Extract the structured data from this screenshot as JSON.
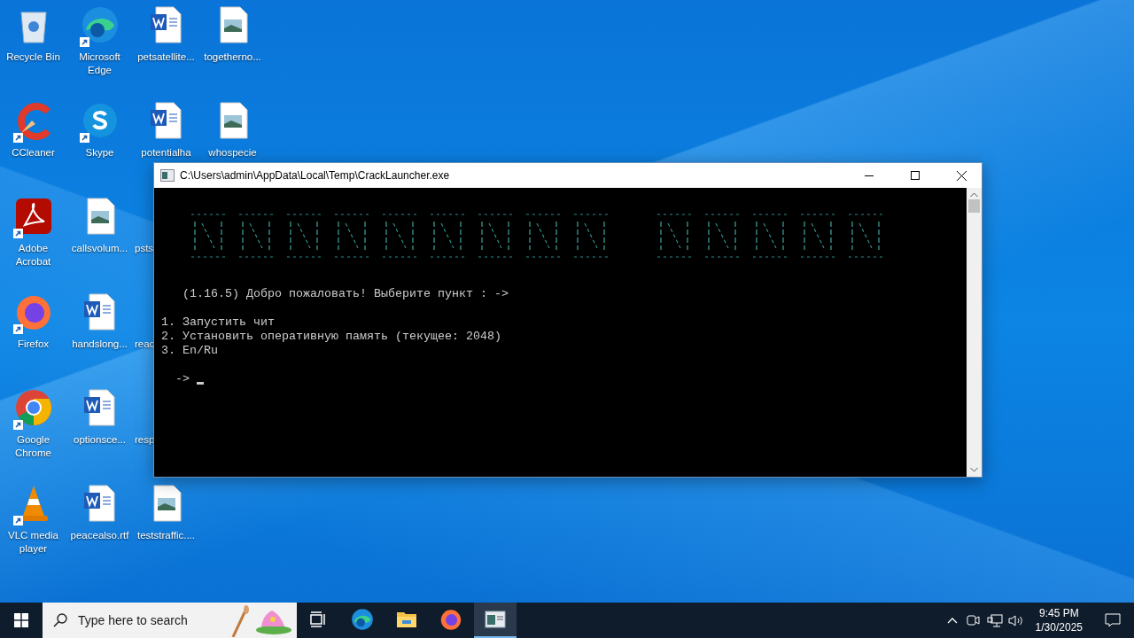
{
  "desktop_icons": [
    {
      "label": "Recycle Bin",
      "kind": "recycle-bin",
      "shortcut": false
    },
    {
      "label": "CCleaner",
      "kind": "ccleaner",
      "shortcut": true
    },
    {
      "label": "Adobe Acrobat",
      "kind": "acrobat",
      "shortcut": true
    },
    {
      "label": "Firefox",
      "kind": "firefox",
      "shortcut": true
    },
    {
      "label": "Google Chrome",
      "kind": "chrome",
      "shortcut": true
    },
    {
      "label": "VLC media player",
      "kind": "vlc",
      "shortcut": true
    },
    {
      "label": "Microsoft Edge",
      "kind": "edge",
      "shortcut": true
    },
    {
      "label": "Skype",
      "kind": "skype",
      "shortcut": true
    },
    {
      "label": "callsvolum...",
      "kind": "image",
      "shortcut": false
    },
    {
      "label": "handslong...",
      "kind": "word",
      "shortcut": false
    },
    {
      "label": "optionsce...",
      "kind": "word",
      "shortcut": false
    },
    {
      "label": "peacealso.rtf",
      "kind": "word",
      "shortcut": false
    },
    {
      "label": "petsatellite...",
      "kind": "word",
      "shortcut": false
    },
    {
      "label": "potentialha",
      "kind": "word",
      "shortcut": false
    },
    {
      "label": "psts",
      "kind": "hidden",
      "shortcut": false
    },
    {
      "label": "reac",
      "kind": "hidden",
      "shortcut": false
    },
    {
      "label": "resp",
      "kind": "hidden",
      "shortcut": false
    },
    {
      "label": "teststraffic....",
      "kind": "image",
      "shortcut": false
    },
    {
      "label": "togetherno...",
      "kind": "image",
      "shortcut": false
    },
    {
      "label": "whospecie",
      "kind": "image",
      "shortcut": false
    }
  ],
  "console": {
    "title": "C:\\Users\\admin\\AppData\\Local\\Temp\\CrackLauncher.exe",
    "greeting": "(1.16.5) Добро пожаловать! Выберите пункт : ->",
    "menu": [
      "1. Запустить чит",
      "2. Установить оперативную память (текущее: 2048)",
      "3. En/Ru"
    ],
    "prompt": "->"
  },
  "taskbar": {
    "search_placeholder": "Type here to search",
    "apps": [
      {
        "kind": "task-view",
        "selected": false
      },
      {
        "kind": "edge",
        "selected": false
      },
      {
        "kind": "explorer",
        "selected": false
      },
      {
        "kind": "firefox",
        "selected": false
      },
      {
        "kind": "console",
        "selected": true
      }
    ],
    "time": "9:45 PM",
    "date": "1/30/2025"
  }
}
